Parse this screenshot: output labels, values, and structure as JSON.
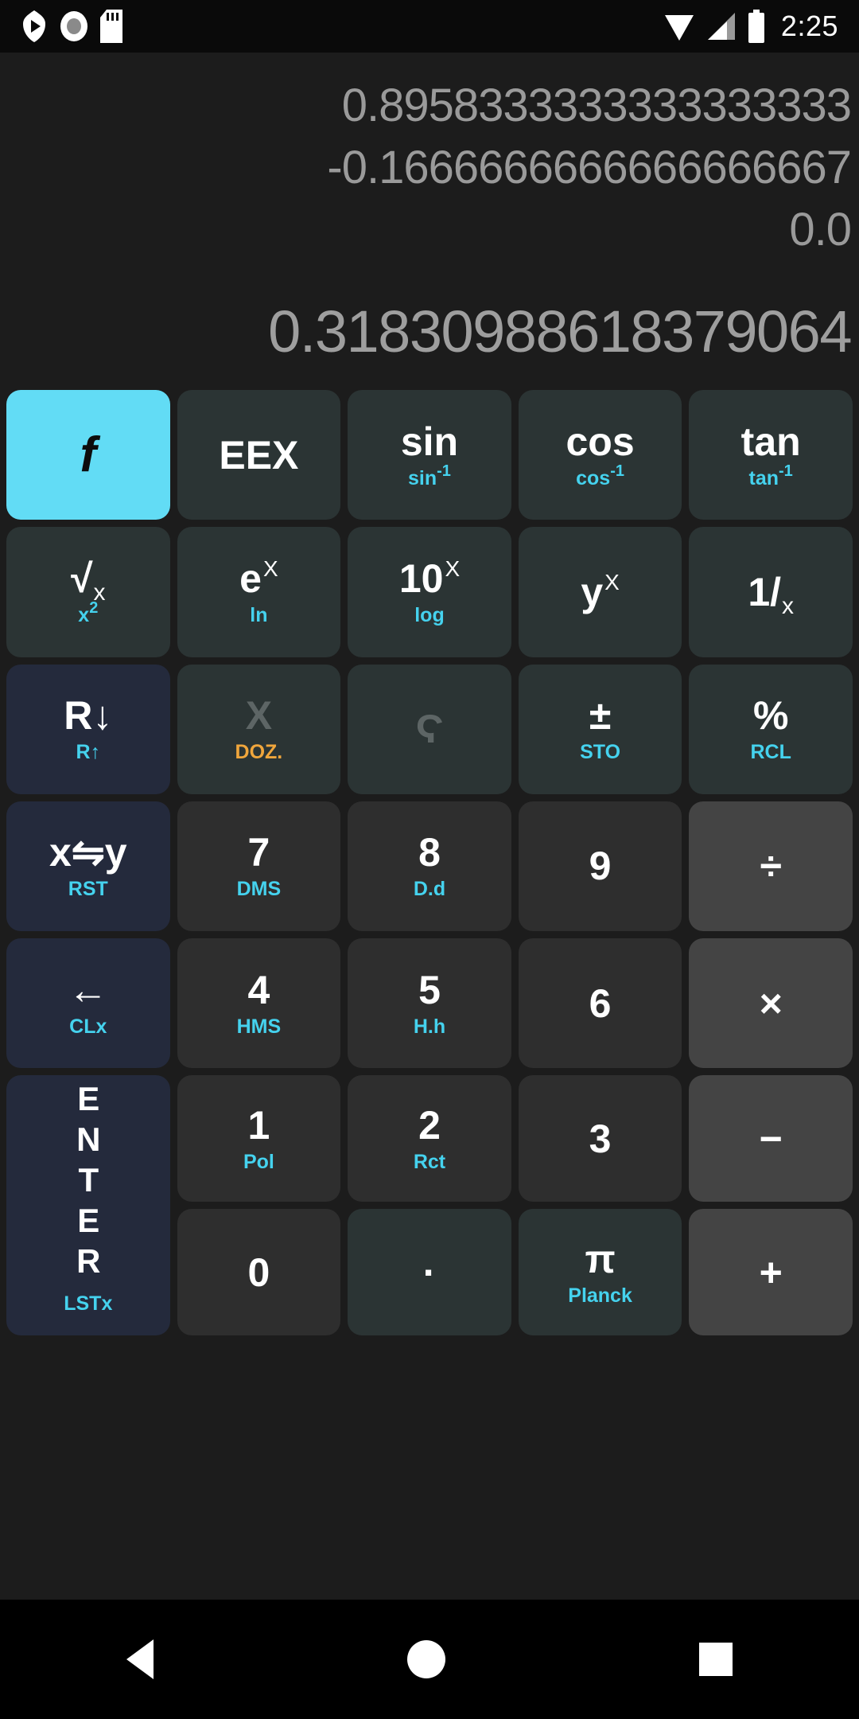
{
  "statusbar": {
    "time": "2:25",
    "icons_left": [
      "play-badge-icon",
      "record-icon",
      "sd-card-icon"
    ],
    "icons_right": [
      "wifi-icon",
      "cell-signal-icon",
      "battery-icon"
    ]
  },
  "display": {
    "stack": [
      "0.8958333333333333333",
      "-0.1666666666666666667",
      "0.0"
    ],
    "x_register": "0.31830988618379064"
  },
  "colors": {
    "accent": "#62dcf5",
    "shift_label": "#45d2ee",
    "doz_label": "#f0a63c",
    "screen_bg": "#1c1c1c",
    "key_bg": "#2e2e2e",
    "key_teal_bg": "#2b3434",
    "key_blue_bg": "#242a3c",
    "key_op_bg": "#444444"
  },
  "keypad": {
    "rows": [
      [
        {
          "name": "f-shift",
          "main": "f",
          "sub": ""
        },
        {
          "name": "eex",
          "main": "EEX",
          "sub": ""
        },
        {
          "name": "sin",
          "main": "sin",
          "sub": "sin-1"
        },
        {
          "name": "cos",
          "main": "cos",
          "sub": "cos-1"
        },
        {
          "name": "tan",
          "main": "tan",
          "sub": "tan-1"
        }
      ],
      [
        {
          "name": "sqrt-x",
          "main": "√x",
          "sub": "x2"
        },
        {
          "name": "e-pow-x",
          "main": "eX",
          "sub": "ln"
        },
        {
          "name": "ten-pow-x",
          "main": "10X",
          "sub": "log"
        },
        {
          "name": "y-pow-x",
          "main": "yX",
          "sub": ""
        },
        {
          "name": "reciprocal",
          "main": "1/x",
          "sub": ""
        }
      ],
      [
        {
          "name": "roll-down",
          "main": "R↓",
          "sub": "R↑"
        },
        {
          "name": "chi-doz",
          "main": "Χ",
          "sub": "DOZ."
        },
        {
          "name": "sigma",
          "main": "Ϛ",
          "sub": ""
        },
        {
          "name": "plus-minus",
          "main": "±",
          "sub": "STO"
        },
        {
          "name": "percent",
          "main": "%",
          "sub": "RCL"
        }
      ],
      [
        {
          "name": "swap-xy",
          "main": "x⇋y",
          "sub": "RST"
        },
        {
          "name": "digit-7",
          "main": "7",
          "sub": "DMS"
        },
        {
          "name": "digit-8",
          "main": "8",
          "sub": "D.d"
        },
        {
          "name": "digit-9",
          "main": "9",
          "sub": ""
        },
        {
          "name": "divide",
          "main": "÷",
          "sub": ""
        }
      ],
      [
        {
          "name": "backspace",
          "main": "←",
          "sub": "CLx"
        },
        {
          "name": "digit-4",
          "main": "4",
          "sub": "HMS"
        },
        {
          "name": "digit-5",
          "main": "5",
          "sub": "H.h"
        },
        {
          "name": "digit-6",
          "main": "6",
          "sub": ""
        },
        {
          "name": "multiply",
          "main": "×",
          "sub": ""
        }
      ],
      [
        {
          "name": "enter",
          "main": "ENTER",
          "sub": "LSTx"
        },
        {
          "name": "digit-1",
          "main": "1",
          "sub": "Pol"
        },
        {
          "name": "digit-2",
          "main": "2",
          "sub": "Rct"
        },
        {
          "name": "digit-3",
          "main": "3",
          "sub": ""
        },
        {
          "name": "minus",
          "main": "−",
          "sub": ""
        }
      ],
      [
        {
          "name": "digit-0",
          "main": "0",
          "sub": ""
        },
        {
          "name": "decimal-point",
          "main": "·",
          "sub": ""
        },
        {
          "name": "pi",
          "main": "π",
          "sub": "Planck"
        },
        {
          "name": "plus",
          "main": "+",
          "sub": ""
        }
      ]
    ]
  },
  "navbar": {
    "back": "back-nav-icon",
    "home": "home-nav-icon",
    "recents": "recents-nav-icon"
  }
}
